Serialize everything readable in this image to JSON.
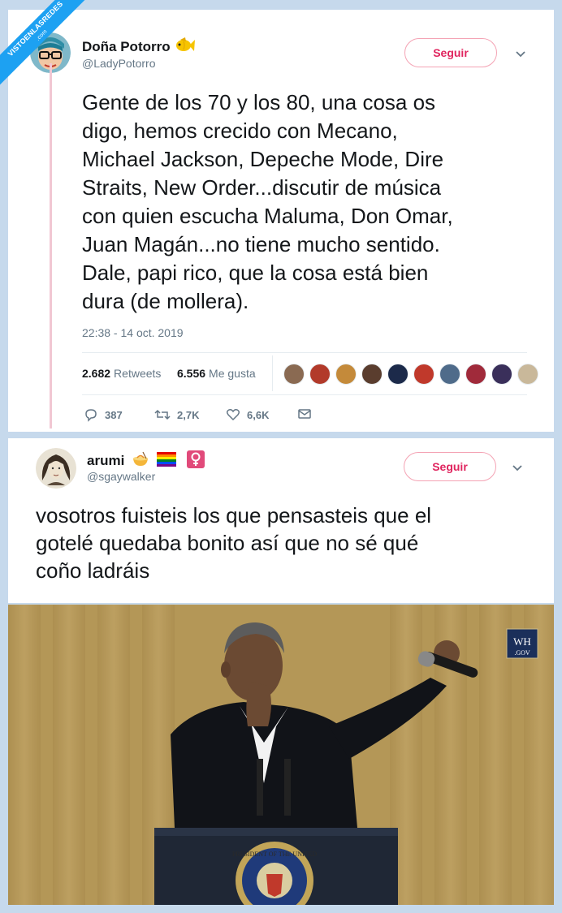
{
  "watermark": {
    "line1": "VISTOENLASREDES",
    "line2": ".com"
  },
  "tweet1": {
    "name": "Doña Potorro",
    "handle": "@LadyPotorro",
    "follow_label": "Seguir",
    "text_lines": [
      "Gente de los 70 y los 80, una cosa os",
      "digo, hemos crecido con Mecano,",
      "Michael Jackson, Depeche Mode, Dire",
      "Straits, New Order...discutir de música",
      "con quien escucha Maluma, Don Omar,",
      "Juan Magán...no tiene mucho sentido.",
      "Dale, papi rico, que la cosa está bien",
      "dura (de mollera)."
    ],
    "timestamp": "22:38 - 14 oct. 2019",
    "retweets_count": "2.682",
    "retweets_label": "Retweets",
    "likes_count": "6.556",
    "likes_label": "Me gusta",
    "actions": {
      "replies": "387",
      "retweets": "2,7K",
      "likes": "6,6K"
    },
    "liker_colors": [
      "#8a6a52",
      "#b23a2a",
      "#c48a3a",
      "#5a3d2e",
      "#1c2a4a",
      "#c0392b",
      "#4f6b8a",
      "#a02a3a",
      "#3a2f5a",
      "#c9b89a"
    ]
  },
  "tweet2": {
    "name": "arumi",
    "handle": "@sgaywalker",
    "follow_label": "Seguir",
    "text_lines": [
      "vosotros fuisteis los que pensasteis que el",
      "gotelé quedaba bonito así que no sé qué",
      "coño ladráis"
    ]
  },
  "photo": {
    "badge_line1": "WH",
    "badge_line2": ".GOV",
    "seal_text": "PRESIDENT OF THE UNITED"
  },
  "colors": {
    "accent": "#1da1f2",
    "follow": "#e0245e",
    "background": "#c6d9ec"
  }
}
